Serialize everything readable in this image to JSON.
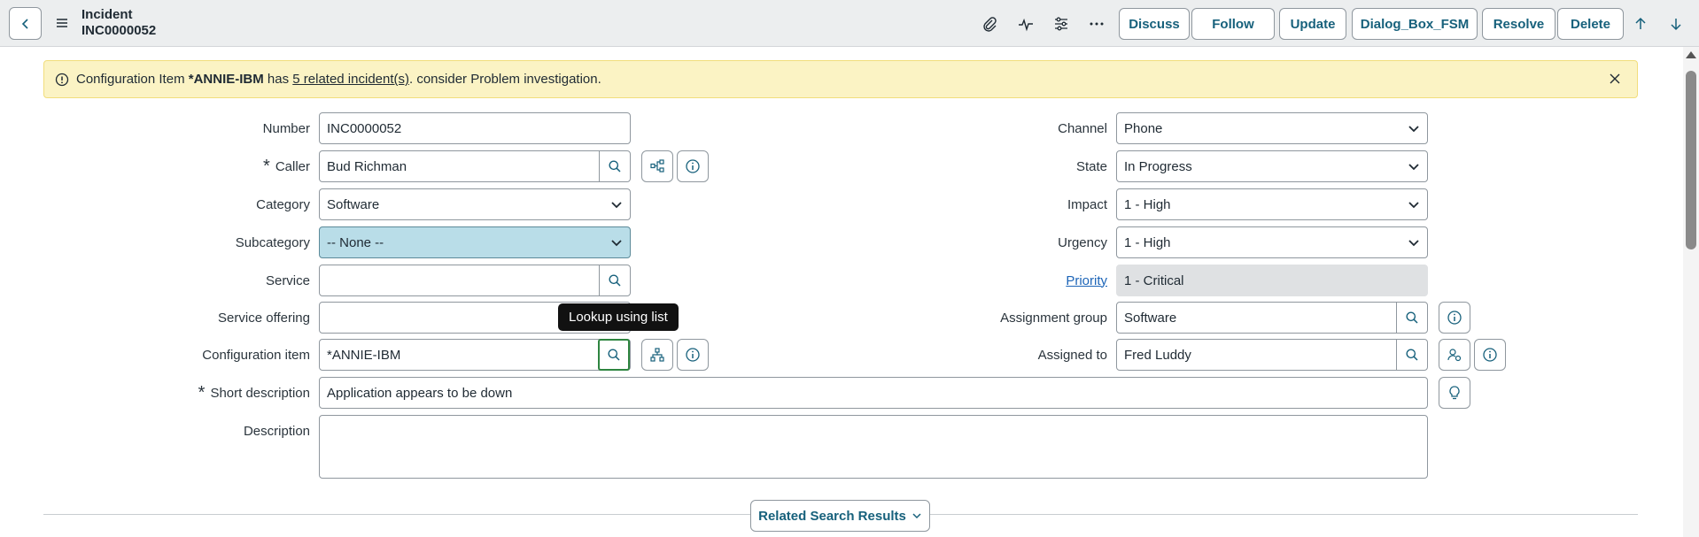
{
  "header": {
    "title": "Incident",
    "number": "INC0000052",
    "buttons": {
      "discuss": "Discuss",
      "follow": "Follow",
      "update": "Update",
      "dialog": "Dialog_Box_FSM",
      "resolve": "Resolve",
      "delete": "Delete"
    }
  },
  "banner": {
    "prefix": "Configuration Item ",
    "ci": "*ANNIE-IBM",
    "middle": " has ",
    "link": "5 related incident(s)",
    "suffix": ". consider Problem investigation."
  },
  "form": {
    "number": {
      "label": "Number",
      "value": "INC0000052"
    },
    "caller": {
      "label": "Caller",
      "value": "Bud Richman"
    },
    "category": {
      "label": "Category",
      "value": "Software"
    },
    "subcategory": {
      "label": "Subcategory",
      "value": "-- None --"
    },
    "service": {
      "label": "Service",
      "value": ""
    },
    "service_offering": {
      "label": "Service offering",
      "value": ""
    },
    "configuration_item": {
      "label": "Configuration item",
      "value": "*ANNIE-IBM"
    },
    "short_description": {
      "label": "Short description",
      "value": "Application appears to be down"
    },
    "description": {
      "label": "Description",
      "value": ""
    },
    "channel": {
      "label": "Channel",
      "value": "Phone"
    },
    "state": {
      "label": "State",
      "value": "In Progress"
    },
    "impact": {
      "label": "Impact",
      "value": "1 - High"
    },
    "urgency": {
      "label": "Urgency",
      "value": "1 - High"
    },
    "priority": {
      "label": "Priority",
      "value": "1 - Critical"
    },
    "assignment_group": {
      "label": "Assignment group",
      "value": "Software"
    },
    "assigned_to": {
      "label": "Assigned to",
      "value": "Fred Luddy"
    }
  },
  "tooltip": "Lookup using list",
  "related_search": "Related Search Results",
  "colors": {
    "accent": "#17617c",
    "banner_bg": "#fbf3c4",
    "highlight": "#b9dde8",
    "link": "#1d65b8"
  }
}
